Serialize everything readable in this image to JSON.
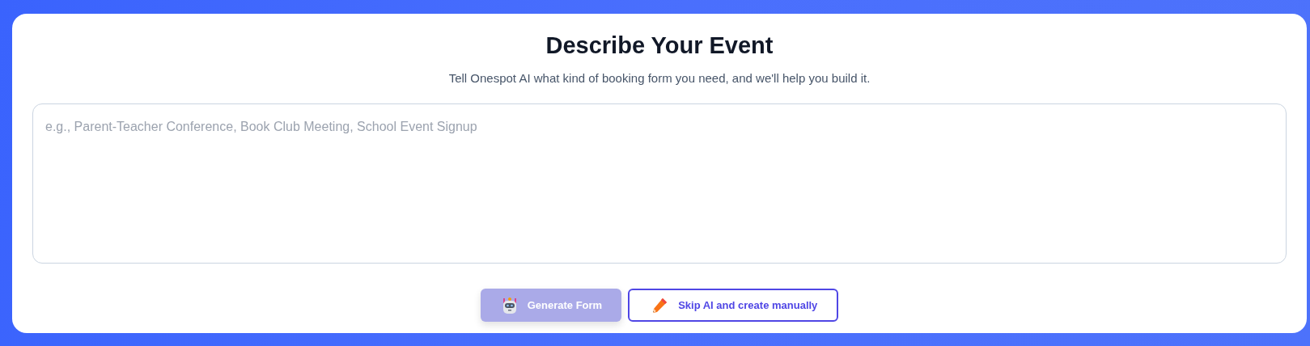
{
  "title": "Describe Your Event",
  "subtitle": "Tell Onespot AI what kind of booking form you need, and we'll help you build it.",
  "description_field": {
    "placeholder": "e.g., Parent-Teacher Conference, Book Club Meeting, School Event Signup"
  },
  "buttons": [
    {
      "kind": "primary",
      "label": "Generate Form",
      "disabled": true
    },
    {
      "kind": "outline",
      "label": "Skip AI and create manually",
      "disabled": false
    }
  ]
}
